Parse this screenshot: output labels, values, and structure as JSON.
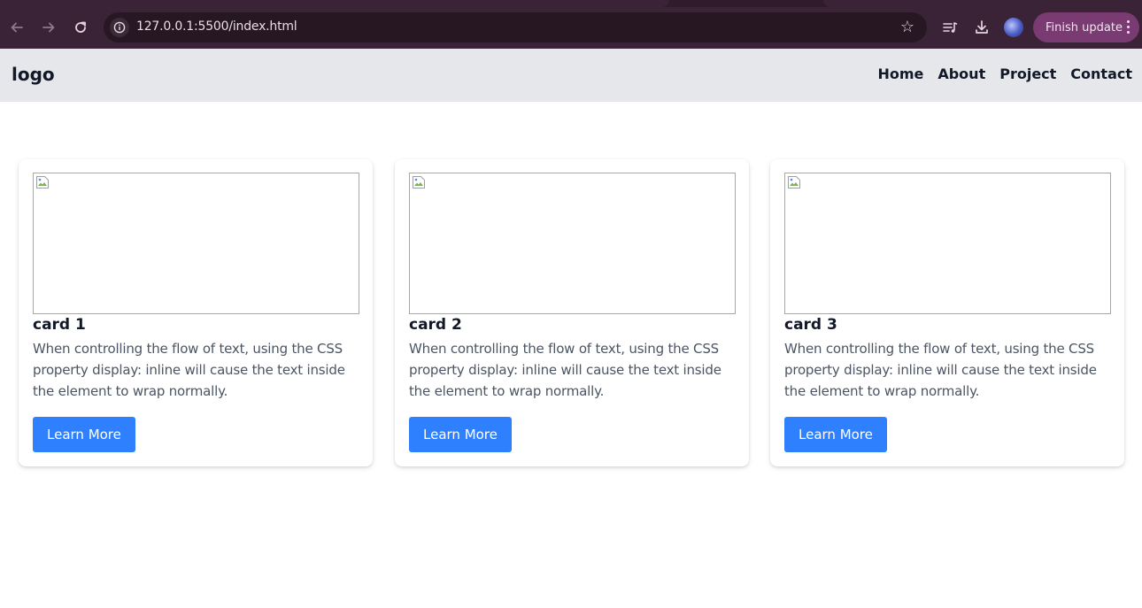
{
  "browser": {
    "url": "127.0.0.1:5500/index.html",
    "update_label": "Finish update",
    "icons": {
      "back": "back-arrow-icon",
      "forward": "forward-arrow-icon",
      "reload": "reload-icon",
      "site_info": "site-info-icon",
      "bookmark": "star-icon",
      "media": "media-control-icon",
      "downloads": "download-icon",
      "profile": "profile-avatar",
      "menu": "kebab-menu-icon"
    },
    "colors": {
      "frame": "#3a2336",
      "omnibox": "#261723",
      "update_button": "#7a3a72"
    }
  },
  "site_nav": {
    "logo": "logo",
    "links": [
      "Home",
      "About",
      "Project",
      "Contact"
    ],
    "background": "#e5e7eb"
  },
  "cards": [
    {
      "title": "card 1",
      "text": "When controlling the flow of text, using the CSS property display: inline will cause the text inside the element to wrap normally.",
      "button": "Learn More"
    },
    {
      "title": "card 2",
      "text": "When controlling the flow of text, using the CSS property display: inline will cause the text inside the element to wrap normally.",
      "button": "Learn More"
    },
    {
      "title": "card 3",
      "text": "When controlling the flow of text, using the CSS property display: inline will cause the text inside the element to wrap normally.",
      "button": "Learn More"
    }
  ],
  "theme": {
    "button_color": "#2f80ff",
    "text_color": "#4b5563",
    "title_color": "#111827"
  }
}
